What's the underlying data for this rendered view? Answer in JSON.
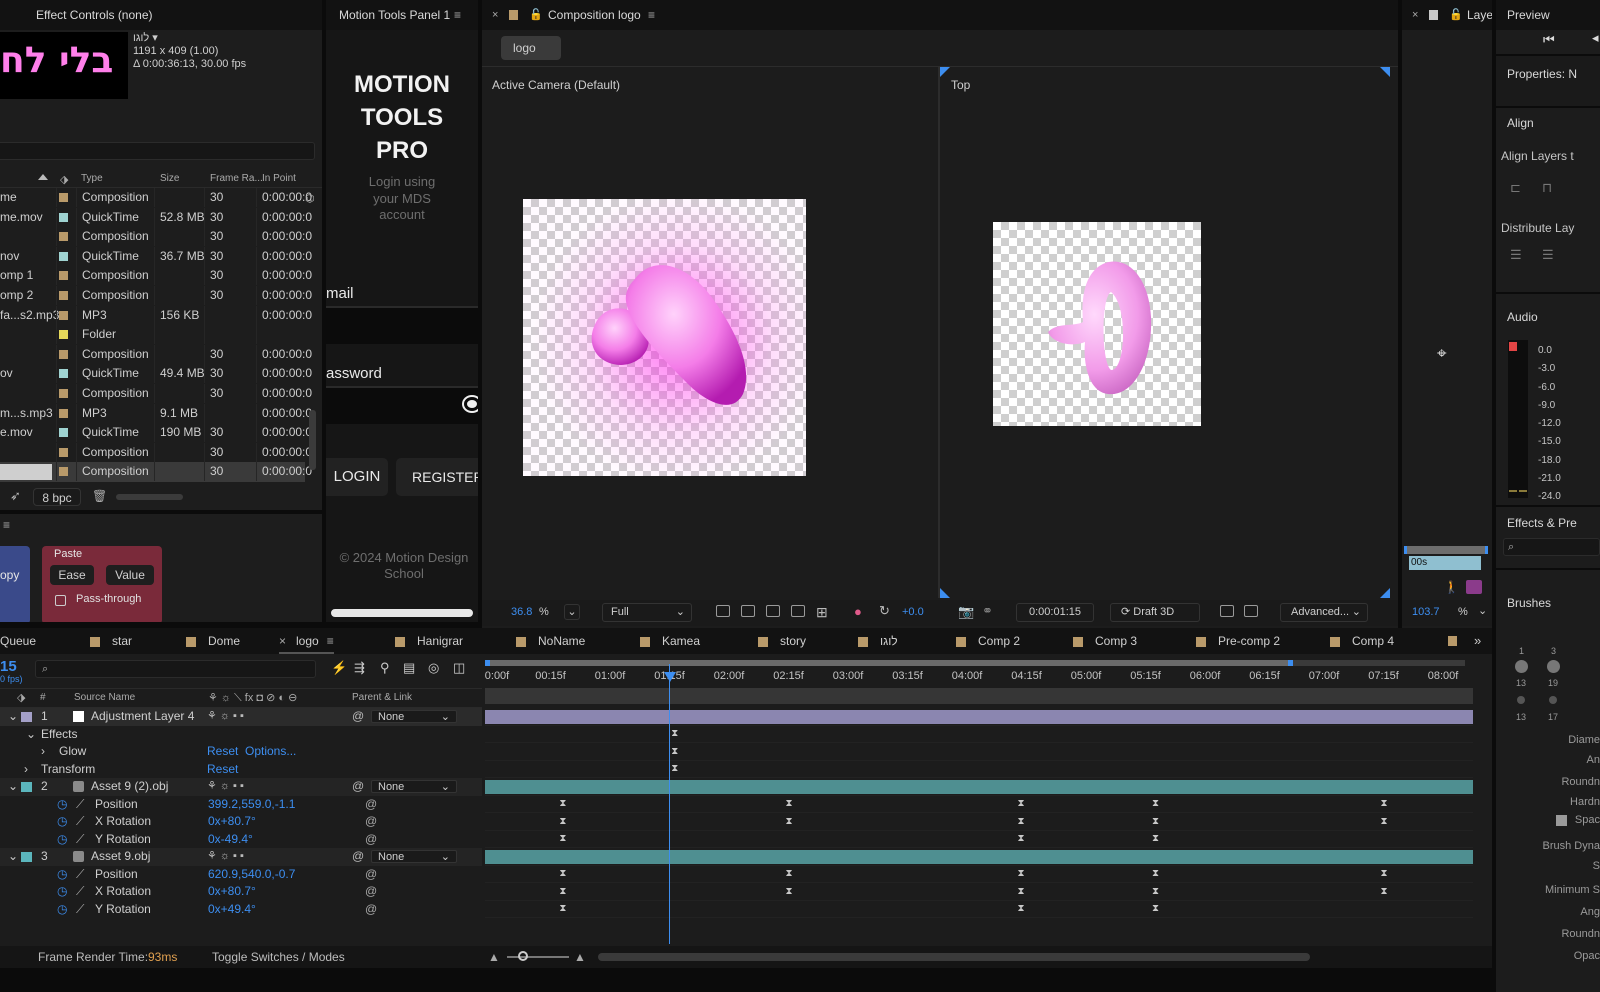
{
  "effect_controls": {
    "title": "Effect Controls (none)",
    "comp_name": "לוגו",
    "comp_name_arrow": "▾",
    "dims": "1191 x 409 (1.00)",
    "duration": "Δ 0:00:36:13, 30.00 fps",
    "thumb_text": "בלי לח"
  },
  "project": {
    "columns": [
      "Type",
      "Size",
      "Frame Ra...",
      "In Point"
    ],
    "rows": [
      {
        "name": "me",
        "type": "Composition",
        "color": "#b99a6a",
        "size": "",
        "fps": "30",
        "in": "0:00:00:0"
      },
      {
        "name": "me.mov",
        "type": "QuickTime",
        "color": "#9fd3d1",
        "size": "52.8 MB",
        "fps": "30",
        "in": "0:00:00:0"
      },
      {
        "name": "",
        "type": "Composition",
        "color": "#b99a6a",
        "size": "",
        "fps": "30",
        "in": "0:00:00:0"
      },
      {
        "name": "nov",
        "type": "QuickTime",
        "color": "#9fd3d1",
        "size": "36.7 MB",
        "fps": "30",
        "in": "0:00:00:0"
      },
      {
        "name": "omp 1",
        "type": "Composition",
        "color": "#b99a6a",
        "size": "",
        "fps": "30",
        "in": "0:00:00:0"
      },
      {
        "name": "omp 2",
        "type": "Composition",
        "color": "#b99a6a",
        "size": "",
        "fps": "30",
        "in": "0:00:00:0"
      },
      {
        "name": "fa...s2.mp3",
        "type": "MP3",
        "color": "#b99a6a",
        "size": "156 KB",
        "fps": "",
        "in": "0:00:00:0"
      },
      {
        "name": "",
        "type": "Folder",
        "color": "#e5d85a",
        "size": "",
        "fps": "",
        "in": ""
      },
      {
        "name": "",
        "type": "Composition",
        "color": "#b99a6a",
        "size": "",
        "fps": "30",
        "in": "0:00:00:0"
      },
      {
        "name": "ov",
        "type": "QuickTime",
        "color": "#9fd3d1",
        "size": "49.4 MB",
        "fps": "30",
        "in": "0:00:00:0"
      },
      {
        "name": "",
        "type": "Composition",
        "color": "#b99a6a",
        "size": "",
        "fps": "30",
        "in": "0:00:00:0"
      },
      {
        "name": "m...s.mp3",
        "type": "MP3",
        "color": "#b99a6a",
        "size": "9.1 MB",
        "fps": "",
        "in": "0:00:00:0"
      },
      {
        "name": "e.mov",
        "type": "QuickTime",
        "color": "#9fd3d1",
        "size": "190 MB",
        "fps": "30",
        "in": "0:00:00:0"
      },
      {
        "name": "",
        "type": "Composition",
        "color": "#b99a6a",
        "size": "",
        "fps": "30",
        "in": "0:00:00:0"
      },
      {
        "name": "",
        "type": "Composition",
        "color": "#b99a6a",
        "size": "",
        "fps": "30",
        "in": "0:00:00:0",
        "selected": true
      }
    ],
    "bpc": "8 bpc"
  },
  "ease_panel": {
    "copy_label": "opy",
    "paste_label": "Paste",
    "ease_label": "Ease",
    "value_label": "Value",
    "pass_through_label": "Pass-through"
  },
  "motion_tools": {
    "tab_title": "Motion Tools Panel 1",
    "title_lines": [
      "MOTION",
      "TOOLS",
      "PRO"
    ],
    "login_hint": "Login using your MDS account",
    "email_label": "mail",
    "password_label": "assword",
    "login_button": "LOGIN",
    "register_button": "REGISTER",
    "copyright": "© 2024 Motion Design School"
  },
  "composition": {
    "tab_title": "Composition logo",
    "tab_chip": "logo",
    "left_view_label": "Active Camera (Default)",
    "right_view_label": "Top",
    "zoom": "36.8",
    "zoom_unit": "%",
    "resolution": "Full",
    "exposure": "+0.0",
    "timecode": "0:00:01:15",
    "renderer": "Draft 3D",
    "advanced": "Advanced..."
  },
  "layer_panel": {
    "tab_title": "Laye",
    "time_chip": "00s",
    "zoom": "103.7",
    "zoom_unit": "%"
  },
  "right_column": {
    "preview_title": "Preview",
    "properties_title": "Properties: N",
    "align_title": "Align",
    "align_layers_label": "Align Layers t",
    "distribute_label": "Distribute Lay",
    "audio_title": "Audio",
    "audio_scale": [
      "0.0",
      "-3.0",
      "-6.0",
      "-9.0",
      "-12.0",
      "-15.0",
      "-18.0",
      "-21.0",
      "-24.0"
    ],
    "effects_title": "Effects & Pre",
    "brushes_title": "Brushes",
    "brush_sizes_top": [
      "1",
      "3"
    ],
    "brush_sizes_mid": [
      "13",
      "19"
    ],
    "brush_sizes_bot": [
      "13",
      "17"
    ],
    "brush_props": [
      "Diame",
      "An",
      "Roundn",
      "Hardn",
      "Spac",
      "Brush Dyna",
      "S",
      "Minimum S",
      "Ang",
      "Roundn",
      "Opac"
    ]
  },
  "timeline": {
    "tabs": [
      {
        "label": "Queue",
        "color": ""
      },
      {
        "label": "star",
        "color": "#b99a6a"
      },
      {
        "label": "Dome",
        "color": "#b99a6a"
      },
      {
        "label": "logo",
        "color": "",
        "active": true
      },
      {
        "label": "Hanigrar",
        "color": "#b99a6a"
      },
      {
        "label": "NoName",
        "color": "#b99a6a"
      },
      {
        "label": "Kamea",
        "color": "#b99a6a"
      },
      {
        "label": "story",
        "color": "#b99a6a"
      },
      {
        "label": "לוגו",
        "color": "#b99a6a"
      },
      {
        "label": "Comp 2",
        "color": "#b99a6a"
      },
      {
        "label": "Comp 3",
        "color": "#b99a6a"
      },
      {
        "label": "Pre-comp 2",
        "color": "#b99a6a"
      },
      {
        "label": "Comp 4",
        "color": "#b99a6a"
      }
    ],
    "current_time": "15",
    "fps_hint": "0 fps)",
    "col_number": "#",
    "col_source": "Source Name",
    "col_parent": "Parent & Link",
    "ruler": [
      "0:00f",
      "00:15f",
      "01:00f",
      "01:15f",
      "02:00f",
      "02:15f",
      "03:00f",
      "03:15f",
      "04:00f",
      "04:15f",
      "05:00f",
      "05:15f",
      "06:00f",
      "06:15f",
      "07:00f",
      "07:15f",
      "08:00f"
    ],
    "layers": [
      {
        "num": "1",
        "name": "Adjustment Layer 4",
        "parent": "None",
        "color": "#a4a0c8"
      },
      {
        "num": "2",
        "name": "Asset 9 (2).obj",
        "parent": "None",
        "color": "#5bb6bd"
      },
      {
        "num": "3",
        "name": "Asset 9.obj",
        "parent": "None",
        "color": "#5bb6bd"
      }
    ],
    "effects_label": "Effects",
    "glow_label": "Glow",
    "glow_reset": "Reset",
    "glow_options": "Options...",
    "transform_label": "Transform",
    "transform_reset": "Reset",
    "l2_props": [
      {
        "name": "Position",
        "value": "399.2,559.0,-1.1"
      },
      {
        "name": "X Rotation",
        "value": "0x+80.7°"
      },
      {
        "name": "Y Rotation",
        "value": "0x-49.4°"
      }
    ],
    "l3_props": [
      {
        "name": "Position",
        "value": "620.9,540.0,-0.7"
      },
      {
        "name": "X Rotation",
        "value": "0x+80.7°"
      },
      {
        "name": "Y Rotation",
        "value": "0x+49.4°"
      }
    ],
    "footer_render_label": "Frame Render Time:",
    "footer_render_value": "93ms",
    "footer_toggle": "Toggle Switches / Modes"
  },
  "colors": {
    "accent": "#3d8ef0",
    "pink": "#ff8ff6",
    "adjustment_bar": "#8b86b0",
    "asset_bar": "#4f8f91"
  }
}
